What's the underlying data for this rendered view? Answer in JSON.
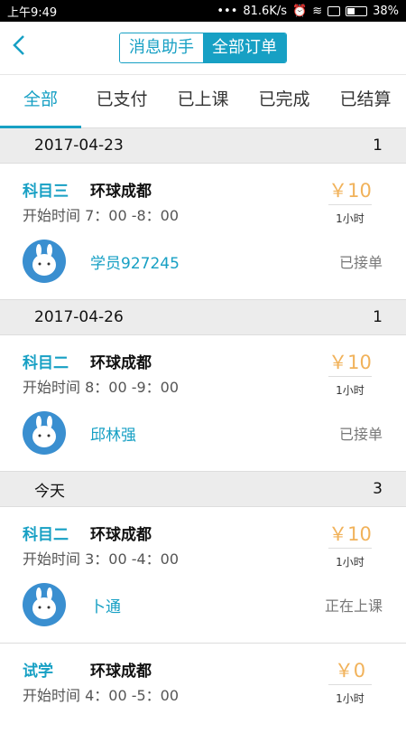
{
  "statusbar": {
    "time": "上午9:49",
    "dots": "•••",
    "speed": "81.6K/s",
    "battery": "38%"
  },
  "header": {
    "segments": [
      "消息助手",
      "全部订单"
    ]
  },
  "tabs": [
    "全部",
    "已支付",
    "已上课",
    "已完成",
    "已结算"
  ],
  "groups": [
    {
      "date": "2017-04-23",
      "count": "1"
    },
    {
      "date": "2017-04-26",
      "count": "1"
    },
    {
      "date": "今天",
      "count": "3"
    }
  ],
  "orders": [
    {
      "subject": "科目三",
      "place": "环球成都",
      "time": "开始时间 7：00 -8：00",
      "price": "￥10",
      "duration": "1小时",
      "student": "学员927245",
      "status": "已接单"
    },
    {
      "subject": "科目二",
      "place": "环球成都",
      "time": "开始时间 8：00 -9：00",
      "price": "￥10",
      "duration": "1小时",
      "student": "邱林强",
      "status": "已接单"
    },
    {
      "subject": "科目二",
      "place": "环球成都",
      "time": "开始时间 3：00 -4：00",
      "price": "￥10",
      "duration": "1小时",
      "student": "卜通",
      "status": "正在上课"
    },
    {
      "subject": "试学",
      "place": "环球成都",
      "time": "开始时间 4：00 -5：00",
      "price": "￥0",
      "duration": "1小时"
    }
  ]
}
